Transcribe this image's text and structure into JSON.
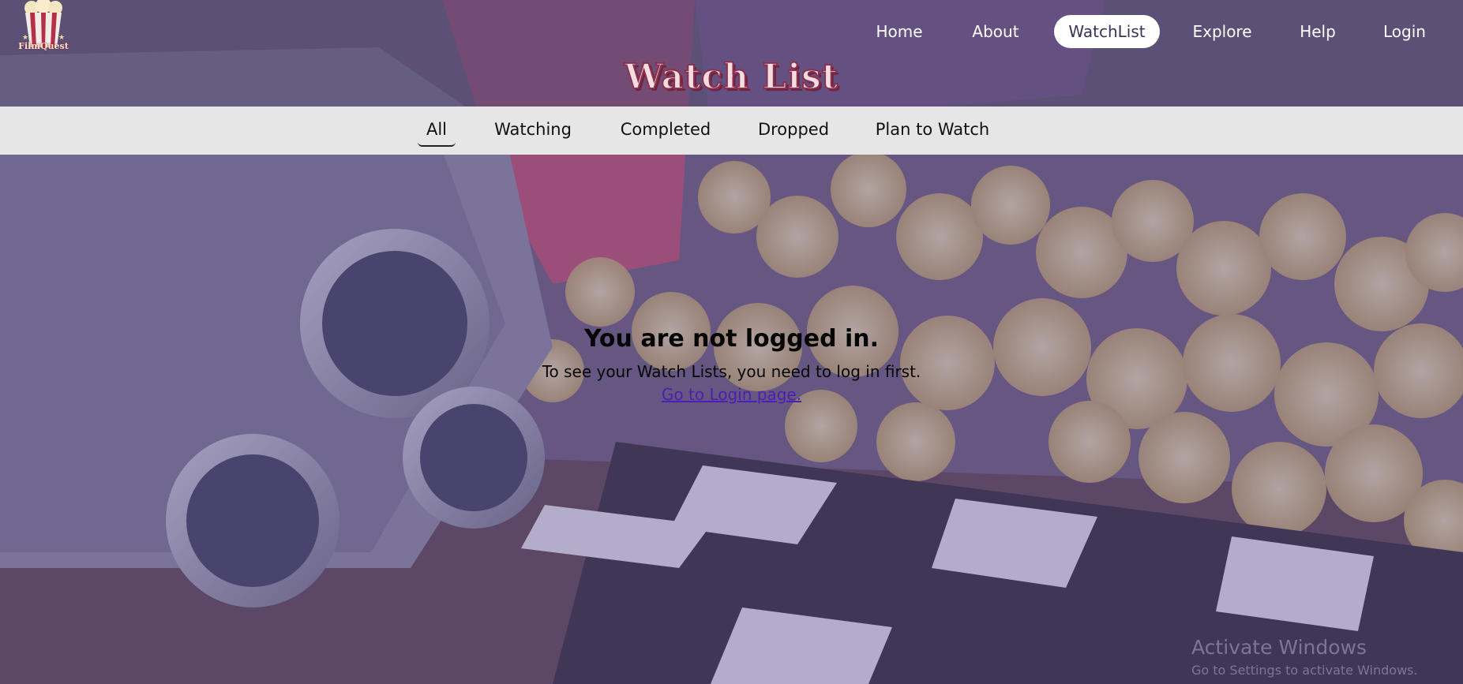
{
  "brand": {
    "name": "FilmQuest"
  },
  "nav": {
    "items": [
      {
        "label": "Home"
      },
      {
        "label": "About"
      },
      {
        "label": "WatchList",
        "active": true
      },
      {
        "label": "Explore"
      },
      {
        "label": "Help"
      },
      {
        "label": "Login"
      }
    ]
  },
  "page": {
    "title": "Watch List"
  },
  "tabs": {
    "items": [
      {
        "label": "All",
        "active": true
      },
      {
        "label": "Watching"
      },
      {
        "label": "Completed"
      },
      {
        "label": "Dropped"
      },
      {
        "label": "Plan to Watch"
      }
    ]
  },
  "message": {
    "title": "You are not logged in.",
    "text": "To see your Watch Lists, you need to log in first.",
    "link": "Go to Login page."
  },
  "watermark": {
    "title": "Activate Windows",
    "subtitle": "Go to Settings to activate Windows."
  },
  "colors": {
    "accent": "#8b3150",
    "tab_bar": "#e6e6e6",
    "link": "#4b1fb0"
  }
}
